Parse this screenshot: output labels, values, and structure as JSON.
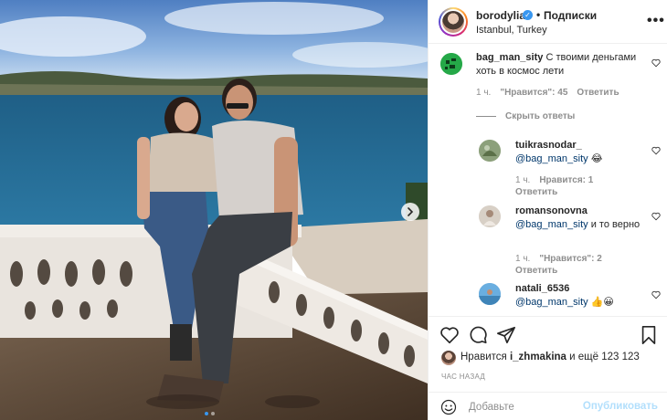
{
  "post": {
    "username": "borodylia",
    "separator": "•",
    "follow_label": "Подписки",
    "location": "Istanbul, Turkey"
  },
  "comments": [
    {
      "username": "bag_man_sity",
      "text": "С твоими деньгами хоть в космос лети",
      "time": "1 ч.",
      "likes": "\"Нравится\": 45",
      "reply": "Ответить"
    }
  ],
  "hide_replies_label": "Скрыть ответы",
  "replies": [
    {
      "username": "tuikrasnodar_",
      "mention": "@bag_man_sity",
      "text": "😂",
      "time": "1 ч.",
      "likes": "Нравится: 1",
      "reply": "Ответить"
    },
    {
      "username": "romansonovna",
      "mention": "@bag_man_sity",
      "text": "и то верно",
      "time": "1 ч.",
      "likes": "\"Нравится\": 2",
      "reply": "Ответить"
    },
    {
      "username": "natali_6536",
      "mention": "@bag_man_sity",
      "text": "👍😀"
    }
  ],
  "likes": {
    "prefix": "Нравится",
    "user": "i_zhmakina",
    "suffix": "и ещё 123 123"
  },
  "post_time": "ЧАС НАЗАД",
  "comment_box": {
    "placeholder": "Добавьте",
    "publish_label": "Опубликовать"
  },
  "colors": {
    "accent": "#3897f0",
    "publish_disabled": "#b2dffc",
    "secondary_text": "#8e8e8e"
  },
  "icons": [
    "verified-badge-icon",
    "more-options-icon",
    "heart-icon",
    "comment-icon",
    "share-icon",
    "bookmark-icon",
    "emoji-icon",
    "next-arrow-icon"
  ]
}
